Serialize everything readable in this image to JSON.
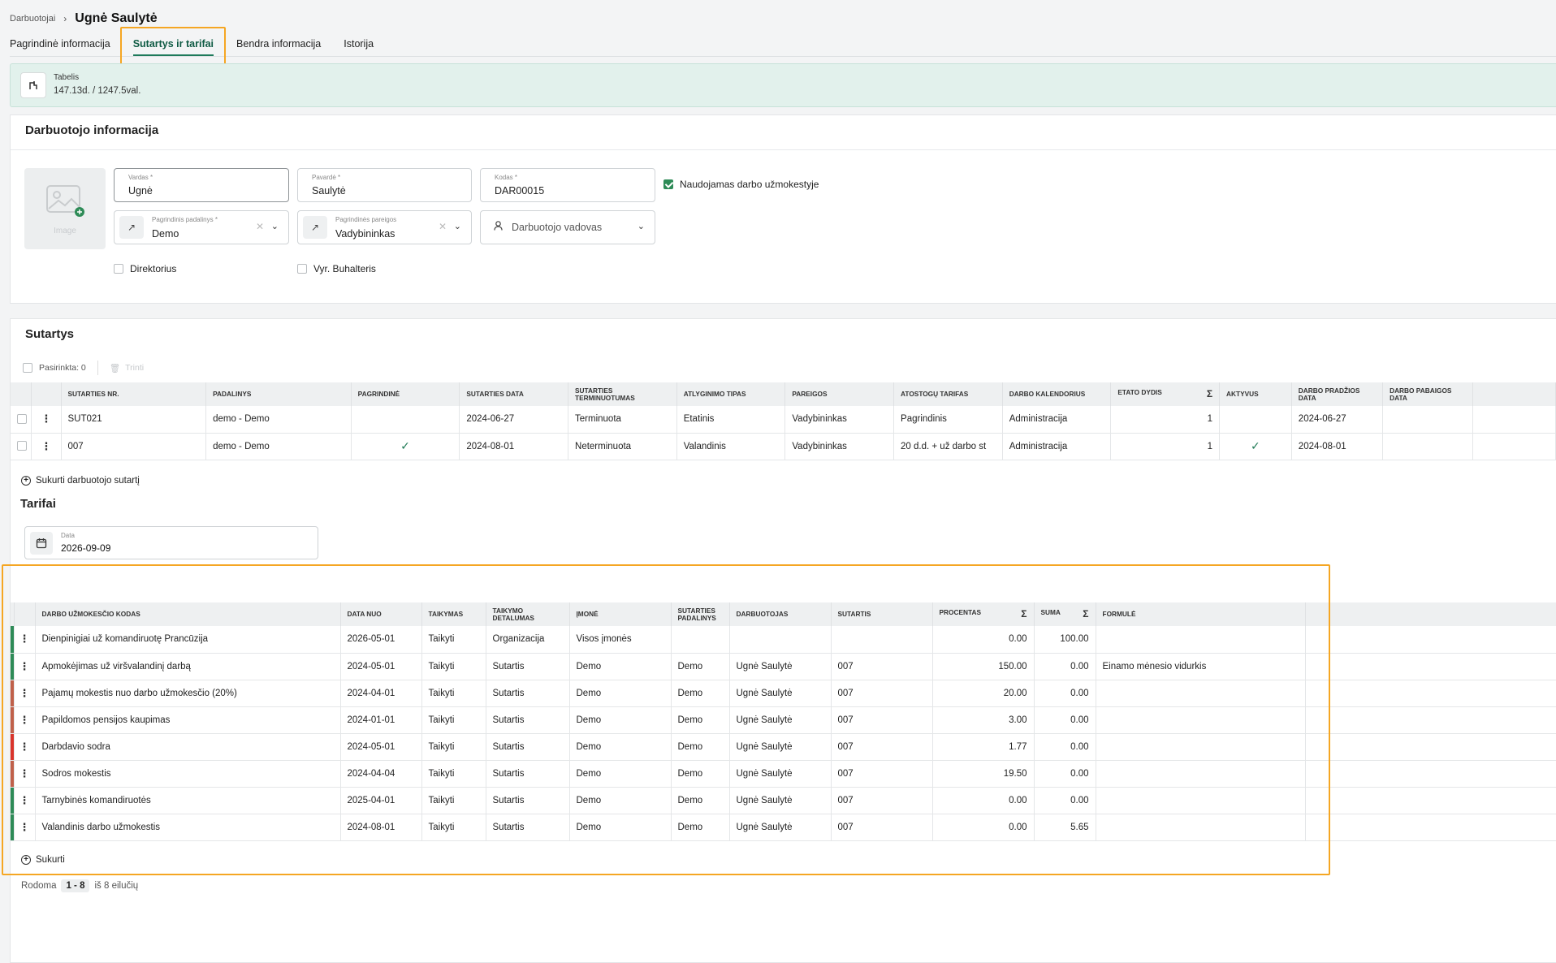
{
  "breadcrumb": {
    "parent": "Darbuotojai",
    "separator": "›",
    "current": "Ugnė Saulytė"
  },
  "tabs": [
    {
      "label": "Pagrindinė informacija"
    },
    {
      "label": "Sutartys ir tarifai"
    },
    {
      "label": "Bendra informacija"
    },
    {
      "label": "Istorija"
    }
  ],
  "banner": {
    "label": "Tabelis",
    "value": "147.13d. / 1247.5val."
  },
  "employee": {
    "title": "Darbuotojo informacija",
    "image_text": "Image",
    "vardas": {
      "label": "Vardas *",
      "value": "Ugnė"
    },
    "pavarde": {
      "label": "Pavardė *",
      "value": "Saulytė"
    },
    "kodas": {
      "label": "Kodas *",
      "value": "DAR00015"
    },
    "payroll_checkbox": "Naudojamas darbo užmokestyje",
    "padalinys": {
      "label": "Pagrindinis padalinys *",
      "value": "Demo"
    },
    "pareigos": {
      "label": "Pagrindinės pareigos",
      "value": "Vadybininkas"
    },
    "vadovas_placeholder": "Darbuotojo vadovas",
    "direktorius": "Direktorius",
    "buhalteris": "Vyr. Buhalteris"
  },
  "contracts": {
    "title": "Sutartys",
    "selected": "Pasirinkta: 0",
    "delete": "Trinti",
    "headers": [
      "Sutarties nr.",
      "Padalinys",
      "Pagrindinė",
      "Sutarties data",
      "Sutarties terminuotumas",
      "Atlyginimo tipas",
      "Pareigos",
      "Atostogų tarifas",
      "Darbo kalendorius",
      "Etato dydis",
      "Aktyvus",
      "Darbo pradžios data",
      "Darbo pabaigos data"
    ],
    "rows": [
      {
        "nr": "SUT021",
        "padalinys": "demo - Demo",
        "pagrindine": "",
        "data": "2024-06-27",
        "terminuotumas": "Terminuota",
        "tipas": "Etatinis",
        "pareigos": "Vadybininkas",
        "atostogu": "Pagrindinis",
        "kalendorius": "Administracija",
        "etatas": "1",
        "aktyvus": "",
        "pradzia": "2024-06-27",
        "pabaiga": ""
      },
      {
        "nr": "007",
        "padalinys": "demo - Demo",
        "pagrindine": "✓",
        "data": "2024-08-01",
        "terminuotumas": "Neterminuota",
        "tipas": "Valandinis",
        "pareigos": "Vadybininkas",
        "atostogu": "20 d.d. + už darbo st",
        "kalendorius": "Administracija",
        "etatas": "1",
        "aktyvus": "✓",
        "pradzia": "2024-08-01",
        "pabaiga": ""
      }
    ],
    "create": "Sukurti darbuotojo sutartį"
  },
  "tariffs": {
    "title": "Tarifai",
    "date_label": "Data",
    "date_value": "2026-09-09",
    "headers": [
      "Darbo užmokesčio kodas",
      "Data nuo",
      "Taikymas",
      "Taikymo detalumas",
      "Įmonė",
      "Sutarties padalinys",
      "Darbuotojas",
      "Sutartis",
      "Procentas",
      "Suma",
      "Formulė"
    ],
    "rows": [
      {
        "color": "#2e8b57",
        "kodas": "Dienpinigiai už komandiruotę Prancūzija",
        "data": "2026-05-01",
        "taikymas": "Taikyti",
        "detalumas": "Organizacija",
        "imone": "Visos įmonės",
        "padalinys": "",
        "darbuotojas": "",
        "sutartis": "",
        "procentas": "0.00",
        "suma": "100.00",
        "formule": ""
      },
      {
        "color": "#2e8b57",
        "kodas": "Apmokėjimas už viršvalandinį darbą",
        "data": "2024-05-01",
        "taikymas": "Taikyti",
        "detalumas": "Sutartis",
        "imone": "Demo",
        "padalinys": "Demo",
        "darbuotojas": "Ugnė Saulytė",
        "sutartis": "007",
        "procentas": "150.00",
        "suma": "0.00",
        "formule": "Einamo mėnesio vidurkis"
      },
      {
        "color": "#c0604a",
        "kodas": "Pajamų mokestis nuo darbo užmokesčio (20%)",
        "data": "2024-04-01",
        "taikymas": "Taikyti",
        "detalumas": "Sutartis",
        "imone": "Demo",
        "padalinys": "Demo",
        "darbuotojas": "Ugnė Saulytė",
        "sutartis": "007",
        "procentas": "20.00",
        "suma": "0.00",
        "formule": ""
      },
      {
        "color": "#c0604a",
        "kodas": "Papildomos pensijos kaupimas",
        "data": "2024-01-01",
        "taikymas": "Taikyti",
        "detalumas": "Sutartis",
        "imone": "Demo",
        "padalinys": "Demo",
        "darbuotojas": "Ugnė Saulytė",
        "sutartis": "007",
        "procentas": "3.00",
        "suma": "0.00",
        "formule": ""
      },
      {
        "color": "#d9342b",
        "kodas": "Darbdavio sodra",
        "data": "2024-05-01",
        "taikymas": "Taikyti",
        "detalumas": "Sutartis",
        "imone": "Demo",
        "padalinys": "Demo",
        "darbuotojas": "Ugnė Saulytė",
        "sutartis": "007",
        "procentas": "1.77",
        "suma": "0.00",
        "formule": ""
      },
      {
        "color": "#c0604a",
        "kodas": "Sodros mokestis",
        "data": "2024-04-04",
        "taikymas": "Taikyti",
        "detalumas": "Sutartis",
        "imone": "Demo",
        "padalinys": "Demo",
        "darbuotojas": "Ugnė Saulytė",
        "sutartis": "007",
        "procentas": "19.50",
        "suma": "0.00",
        "formule": ""
      },
      {
        "color": "#2e8b57",
        "kodas": "Tarnybinės komandiruotės",
        "data": "2025-04-01",
        "taikymas": "Taikyti",
        "detalumas": "Sutartis",
        "imone": "Demo",
        "padalinys": "Demo",
        "darbuotojas": "Ugnė Saulytė",
        "sutartis": "007",
        "procentas": "0.00",
        "suma": "0.00",
        "formule": ""
      },
      {
        "color": "#2e8b57",
        "kodas": "Valandinis darbo užmokestis",
        "data": "2024-08-01",
        "taikymas": "Taikyti",
        "detalumas": "Sutartis",
        "imone": "Demo",
        "padalinys": "Demo",
        "darbuotojas": "Ugnė Saulytė",
        "sutartis": "007",
        "procentas": "0.00",
        "suma": "5.65",
        "formule": ""
      }
    ],
    "create": "Sukurti",
    "pager_prefix": "Rodoma",
    "pager_range": "1 - 8",
    "pager_suffix": "iš 8 eilučių"
  }
}
